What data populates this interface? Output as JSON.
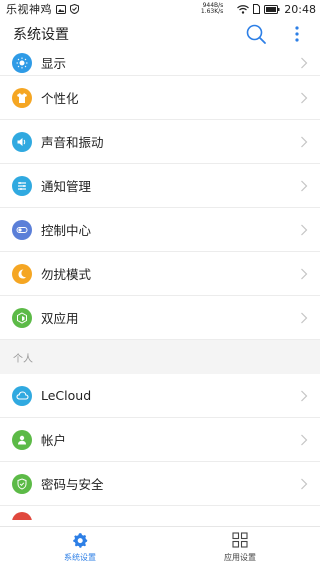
{
  "status_bar": {
    "app_name": "乐视神鸡",
    "net_speed_down": "944B/s",
    "net_speed_up": "1.63K/s",
    "time": "20:48"
  },
  "app_bar": {
    "title": "系统设置"
  },
  "colors": {
    "accent": "#2d7fe6",
    "display_icon": "#2f9be6",
    "personalize_icon": "#f5a623",
    "sound_icon": "#30a9e0",
    "notify_icon": "#30a9e0",
    "control_icon": "#5b7fd8",
    "dnd_icon": "#f5a623",
    "dual_app_icon": "#5cba47",
    "lecloud_icon": "#30a9e0",
    "account_icon": "#5cba47",
    "security_icon": "#5cba47"
  },
  "settings": {
    "items": [
      {
        "label": "显示",
        "icon": "display-icon"
      },
      {
        "label": "个性化",
        "icon": "personalize-icon"
      },
      {
        "label": "声音和振动",
        "icon": "sound-icon"
      },
      {
        "label": "通知管理",
        "icon": "notification-icon"
      },
      {
        "label": "控制中心",
        "icon": "control-center-icon"
      },
      {
        "label": "勿扰模式",
        "icon": "do-not-disturb-icon"
      },
      {
        "label": "双应用",
        "icon": "dual-app-icon"
      }
    ],
    "personal_header": "个人",
    "personal_items": [
      {
        "label": "LeCloud",
        "icon": "cloud-icon"
      },
      {
        "label": "帐户",
        "icon": "account-icon"
      },
      {
        "label": "密码与安全",
        "icon": "security-icon"
      }
    ]
  },
  "bottom_nav": {
    "system_settings": "系统设置",
    "app_settings": "应用设置"
  }
}
